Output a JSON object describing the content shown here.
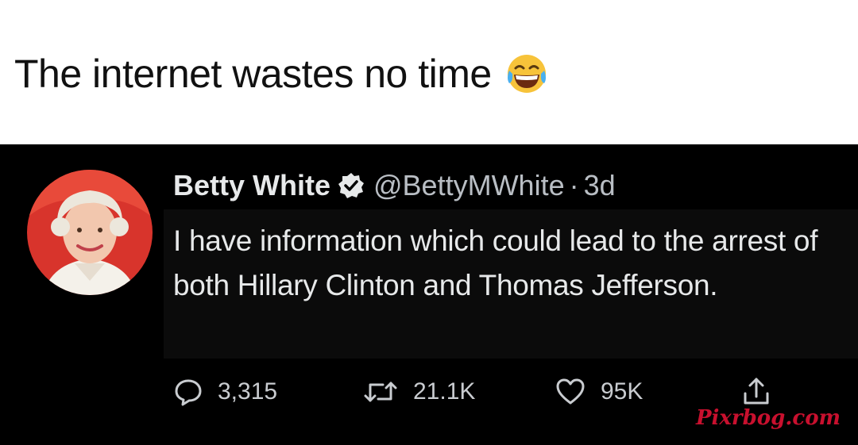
{
  "caption": {
    "text": "The internet wastes no time",
    "emoji": "face-with-tears-of-joy-icon"
  },
  "tweet": {
    "display_name": "Betty White",
    "verified_icon": "verified-badge-icon",
    "handle": "@BettyMWhite",
    "separator": "·",
    "time": "3d",
    "text": "I have information which could lead to the arrest of both Hillary Clinton and Thomas Jefferson.",
    "actions": {
      "reply_count": "3,315",
      "retweet_count": "21.1K",
      "like_count": "95K"
    }
  },
  "watermark": "Pixrbog.com",
  "colors": {
    "tweet_background": "#000000",
    "primary_text": "#e7e9ea",
    "secondary_text": "#b9bec4",
    "watermark": "#c8102e"
  }
}
